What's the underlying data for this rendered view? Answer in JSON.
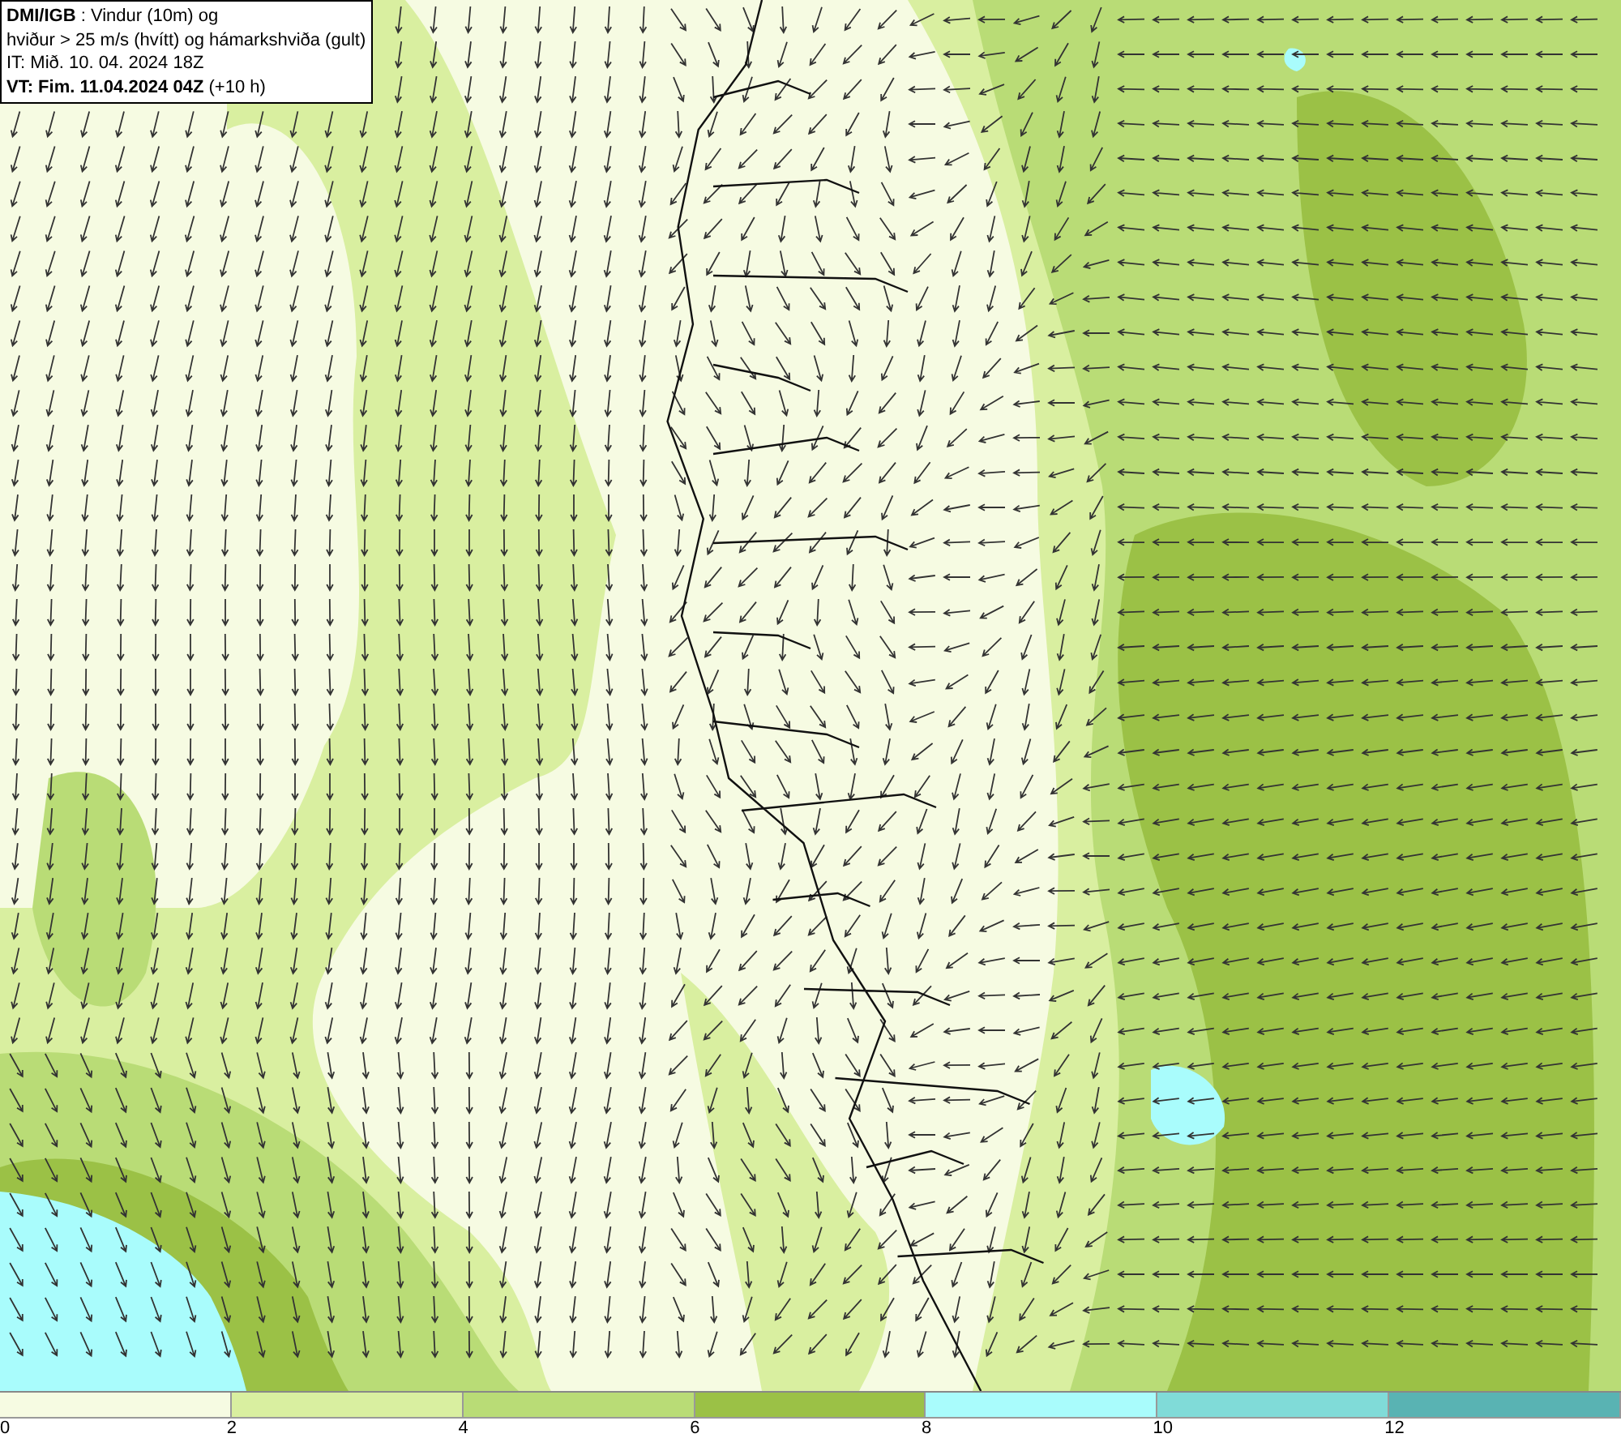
{
  "title_box": {
    "lines": [
      "**DMI/IGB** : Vindur (10m) og",
      "hviður > 25 m/s (hvítt) og hámarkshviða (gult)",
      "IT: Mið. 10. 04. 2024 18Z",
      "**VT: Fim. 11.04.2024 04Z** (+10 h)"
    ]
  },
  "legend": {
    "bins": [
      {
        "label": "0",
        "color": "#f6fbe2"
      },
      {
        "label": "2",
        "color": "#d9efa0"
      },
      {
        "label": "4",
        "color": "#b9dc76"
      },
      {
        "label": "6",
        "color": "#9bc146"
      },
      {
        "label": "8",
        "color": "#a9fcfc"
      },
      {
        "label": "10",
        "color": "#80dbd8"
      },
      {
        "label": "12",
        "color": "#59b3b3"
      }
    ]
  }
}
